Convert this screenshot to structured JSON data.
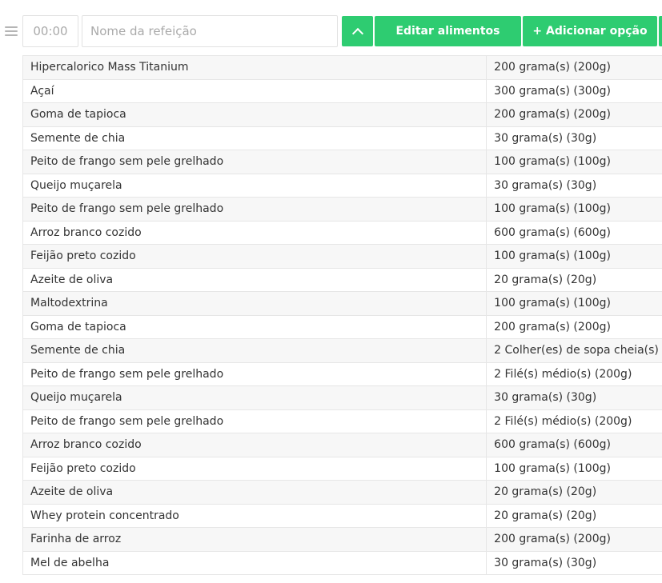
{
  "meal": {
    "time_placeholder": "00:00",
    "name_placeholder": "Nome da refeição"
  },
  "toolbar": {
    "collapse_icon": "chevron-up-icon",
    "edit_label": "Editar alimentos",
    "add_label": "+ Adicionar opção"
  },
  "colors": {
    "accent": "#2ecc71"
  },
  "foods": [
    {
      "name": "Hipercalorico Mass Titanium",
      "quantity": "200 grama(s) (200g)"
    },
    {
      "name": "Açaí",
      "quantity": "300 grama(s) (300g)"
    },
    {
      "name": "Goma de tapioca",
      "quantity": "200 grama(s) (200g)"
    },
    {
      "name": "Semente de chia",
      "quantity": "30 grama(s) (30g)"
    },
    {
      "name": "Peito de frango sem pele grelhado",
      "quantity": "100 grama(s) (100g)"
    },
    {
      "name": "Queijo muçarela",
      "quantity": "30 grama(s) (30g)"
    },
    {
      "name": "Peito de frango sem pele grelhado",
      "quantity": "100 grama(s) (100g)"
    },
    {
      "name": "Arroz branco cozido",
      "quantity": "600 grama(s) (600g)"
    },
    {
      "name": "Feijão preto cozido",
      "quantity": "100 grama(s) (100g)"
    },
    {
      "name": "Azeite de oliva",
      "quantity": "20 grama(s) (20g)"
    },
    {
      "name": "Maltodextrina",
      "quantity": "100 grama(s) (100g)"
    },
    {
      "name": "Goma de tapioca",
      "quantity": "200 grama(s) (200g)"
    },
    {
      "name": "Semente de chia",
      "quantity": "2 Colher(es) de sopa cheia(s)"
    },
    {
      "name": "Peito de frango sem pele grelhado",
      "quantity": "2 Filé(s) médio(s) (200g)"
    },
    {
      "name": "Queijo muçarela",
      "quantity": "30 grama(s) (30g)"
    },
    {
      "name": "Peito de frango sem pele grelhado",
      "quantity": "2 Filé(s) médio(s) (200g)"
    },
    {
      "name": "Arroz branco cozido",
      "quantity": "600 grama(s) (600g)"
    },
    {
      "name": "Feijão preto cozido",
      "quantity": "100 grama(s) (100g)"
    },
    {
      "name": "Azeite de oliva",
      "quantity": "20 grama(s) (20g)"
    },
    {
      "name": "Whey protein concentrado",
      "quantity": "20 grama(s) (20g)"
    },
    {
      "name": "Farinha de arroz",
      "quantity": "200 grama(s) (200g)"
    },
    {
      "name": "Mel de abelha",
      "quantity": "30 grama(s) (30g)"
    }
  ]
}
